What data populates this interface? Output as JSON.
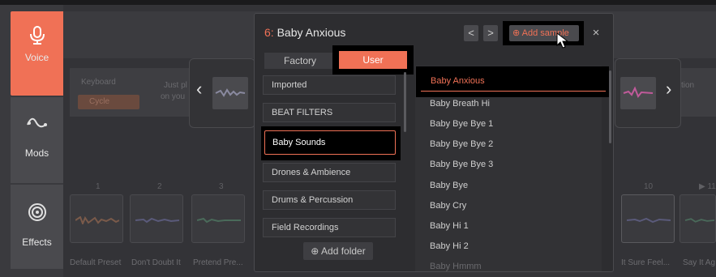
{
  "sidebar": {
    "items": [
      {
        "label": "Voice",
        "icon": "microphone-icon",
        "active": true
      },
      {
        "label": "Mods",
        "icon": "wave-curve-icon",
        "active": false
      },
      {
        "label": "Effects",
        "icon": "target-icon",
        "active": false
      }
    ]
  },
  "background": {
    "keyboard_label": "Keyboard",
    "hint_text": "Just pl",
    "hint_text2": "on you",
    "cycle_label": "Cycle",
    "right_text": "tion",
    "pad_numbers": [
      "1",
      "2",
      "3",
      "10",
      "11"
    ],
    "pad_names": [
      "Default Preset",
      "Don't Doubt It",
      "Pretend Pre...",
      "It Sure Feel...",
      "Say It Ag"
    ]
  },
  "modal": {
    "title_number": "6:",
    "title": "Baby Anxious",
    "prev_symbol": "<",
    "next_symbol": ">",
    "add_sample_label": "Add sample",
    "close_symbol": "×",
    "tabs": {
      "factory": "Factory",
      "user": "User"
    },
    "folders": [
      "Imported",
      "BEAT FILTERS",
      "Baby Sounds",
      "Drones & Ambience",
      "Drums & Percussion",
      "Field Recordings"
    ],
    "selected_folder": "Baby Sounds",
    "add_folder_label": "Add folder",
    "samples": [
      "Baby Anxious",
      "Baby Breath Hi",
      "Baby Bye Bye 1",
      "Baby Bye Bye 2",
      "Baby Bye Bye 3",
      "Baby Bye",
      "Baby Cry",
      "Baby Hi 1",
      "Baby Hi 2",
      "Baby Hmmm"
    ],
    "selected_sample": "Baby Anxious"
  },
  "colors": {
    "accent": "#f07156",
    "panel": "#2d2d30",
    "sidebar": "#3a3a3e"
  }
}
